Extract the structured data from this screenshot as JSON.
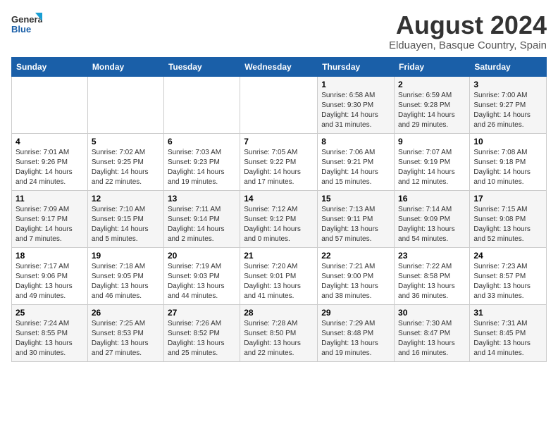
{
  "logo": {
    "general": "General",
    "blue": "Blue"
  },
  "calendar": {
    "title": "August 2024",
    "subtitle": "Elduayen, Basque Country, Spain"
  },
  "weekdays": [
    "Sunday",
    "Monday",
    "Tuesday",
    "Wednesday",
    "Thursday",
    "Friday",
    "Saturday"
  ],
  "weeks": [
    [
      {
        "day": "",
        "info": ""
      },
      {
        "day": "",
        "info": ""
      },
      {
        "day": "",
        "info": ""
      },
      {
        "day": "",
        "info": ""
      },
      {
        "day": "1",
        "info": "Sunrise: 6:58 AM\nSunset: 9:30 PM\nDaylight: 14 hours\nand 31 minutes."
      },
      {
        "day": "2",
        "info": "Sunrise: 6:59 AM\nSunset: 9:28 PM\nDaylight: 14 hours\nand 29 minutes."
      },
      {
        "day": "3",
        "info": "Sunrise: 7:00 AM\nSunset: 9:27 PM\nDaylight: 14 hours\nand 26 minutes."
      }
    ],
    [
      {
        "day": "4",
        "info": "Sunrise: 7:01 AM\nSunset: 9:26 PM\nDaylight: 14 hours\nand 24 minutes."
      },
      {
        "day": "5",
        "info": "Sunrise: 7:02 AM\nSunset: 9:25 PM\nDaylight: 14 hours\nand 22 minutes."
      },
      {
        "day": "6",
        "info": "Sunrise: 7:03 AM\nSunset: 9:23 PM\nDaylight: 14 hours\nand 19 minutes."
      },
      {
        "day": "7",
        "info": "Sunrise: 7:05 AM\nSunset: 9:22 PM\nDaylight: 14 hours\nand 17 minutes."
      },
      {
        "day": "8",
        "info": "Sunrise: 7:06 AM\nSunset: 9:21 PM\nDaylight: 14 hours\nand 15 minutes."
      },
      {
        "day": "9",
        "info": "Sunrise: 7:07 AM\nSunset: 9:19 PM\nDaylight: 14 hours\nand 12 minutes."
      },
      {
        "day": "10",
        "info": "Sunrise: 7:08 AM\nSunset: 9:18 PM\nDaylight: 14 hours\nand 10 minutes."
      }
    ],
    [
      {
        "day": "11",
        "info": "Sunrise: 7:09 AM\nSunset: 9:17 PM\nDaylight: 14 hours\nand 7 minutes."
      },
      {
        "day": "12",
        "info": "Sunrise: 7:10 AM\nSunset: 9:15 PM\nDaylight: 14 hours\nand 5 minutes."
      },
      {
        "day": "13",
        "info": "Sunrise: 7:11 AM\nSunset: 9:14 PM\nDaylight: 14 hours\nand 2 minutes."
      },
      {
        "day": "14",
        "info": "Sunrise: 7:12 AM\nSunset: 9:12 PM\nDaylight: 14 hours\nand 0 minutes."
      },
      {
        "day": "15",
        "info": "Sunrise: 7:13 AM\nSunset: 9:11 PM\nDaylight: 13 hours\nand 57 minutes."
      },
      {
        "day": "16",
        "info": "Sunrise: 7:14 AM\nSunset: 9:09 PM\nDaylight: 13 hours\nand 54 minutes."
      },
      {
        "day": "17",
        "info": "Sunrise: 7:15 AM\nSunset: 9:08 PM\nDaylight: 13 hours\nand 52 minutes."
      }
    ],
    [
      {
        "day": "18",
        "info": "Sunrise: 7:17 AM\nSunset: 9:06 PM\nDaylight: 13 hours\nand 49 minutes."
      },
      {
        "day": "19",
        "info": "Sunrise: 7:18 AM\nSunset: 9:05 PM\nDaylight: 13 hours\nand 46 minutes."
      },
      {
        "day": "20",
        "info": "Sunrise: 7:19 AM\nSunset: 9:03 PM\nDaylight: 13 hours\nand 44 minutes."
      },
      {
        "day": "21",
        "info": "Sunrise: 7:20 AM\nSunset: 9:01 PM\nDaylight: 13 hours\nand 41 minutes."
      },
      {
        "day": "22",
        "info": "Sunrise: 7:21 AM\nSunset: 9:00 PM\nDaylight: 13 hours\nand 38 minutes."
      },
      {
        "day": "23",
        "info": "Sunrise: 7:22 AM\nSunset: 8:58 PM\nDaylight: 13 hours\nand 36 minutes."
      },
      {
        "day": "24",
        "info": "Sunrise: 7:23 AM\nSunset: 8:57 PM\nDaylight: 13 hours\nand 33 minutes."
      }
    ],
    [
      {
        "day": "25",
        "info": "Sunrise: 7:24 AM\nSunset: 8:55 PM\nDaylight: 13 hours\nand 30 minutes."
      },
      {
        "day": "26",
        "info": "Sunrise: 7:25 AM\nSunset: 8:53 PM\nDaylight: 13 hours\nand 27 minutes."
      },
      {
        "day": "27",
        "info": "Sunrise: 7:26 AM\nSunset: 8:52 PM\nDaylight: 13 hours\nand 25 minutes."
      },
      {
        "day": "28",
        "info": "Sunrise: 7:28 AM\nSunset: 8:50 PM\nDaylight: 13 hours\nand 22 minutes."
      },
      {
        "day": "29",
        "info": "Sunrise: 7:29 AM\nSunset: 8:48 PM\nDaylight: 13 hours\nand 19 minutes."
      },
      {
        "day": "30",
        "info": "Sunrise: 7:30 AM\nSunset: 8:47 PM\nDaylight: 13 hours\nand 16 minutes."
      },
      {
        "day": "31",
        "info": "Sunrise: 7:31 AM\nSunset: 8:45 PM\nDaylight: 13 hours\nand 14 minutes."
      }
    ]
  ]
}
